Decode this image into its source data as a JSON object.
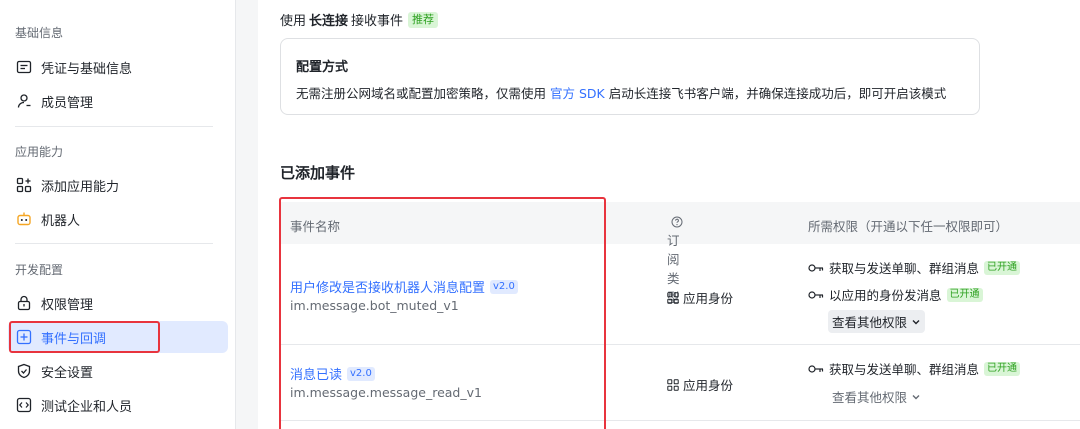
{
  "sidebar": {
    "sections": [
      {
        "title": "基础信息",
        "items": [
          {
            "label": "凭证与基础信息",
            "icon": "id-card-icon"
          },
          {
            "label": "成员管理",
            "icon": "user-icon"
          }
        ]
      },
      {
        "title": "应用能力",
        "items": [
          {
            "label": "添加应用能力",
            "icon": "apps-plus-icon"
          },
          {
            "label": "机器人",
            "icon": "robot-icon"
          }
        ]
      },
      {
        "title": "开发配置",
        "items": [
          {
            "label": "权限管理",
            "icon": "lock-icon"
          },
          {
            "label": "事件与回调",
            "icon": "event-icon"
          },
          {
            "label": "安全设置",
            "icon": "shield-icon"
          },
          {
            "label": "测试企业和人员",
            "icon": "code-icon"
          }
        ]
      }
    ],
    "active_item": "事件与回调"
  },
  "main": {
    "mode": {
      "prefix": "使用",
      "strong": "长连接",
      "suffix": "接收事件",
      "badge": "推荐"
    },
    "config": {
      "title": "配置方式",
      "desc_before": "无需注册公网域名或配置加密策略，仅需使用",
      "link": "官方 SDK",
      "desc_after": "启动长连接飞书客户端，并确保连接成功后，即可开启该模式"
    },
    "added_title": "已添加事件",
    "table": {
      "headers": {
        "name": "事件名称",
        "type": "订阅类型",
        "perm": "所需权限（开通以下任一权限即可）"
      },
      "rows": [
        {
          "name": "用户修改是否接收机器人消息配置",
          "version": "v2.0",
          "code": "im.message.bot_muted_v1",
          "type": "应用身份",
          "perms": [
            {
              "label": "获取与发送单聊、群组消息",
              "status": "已开通"
            },
            {
              "label": "以应用的身份发消息",
              "status": "已开通"
            }
          ],
          "more": "查看其他权限"
        },
        {
          "name": "消息已读",
          "version": "v2.0",
          "code": "im.message.message_read_v1",
          "type": "应用身份",
          "perms": [
            {
              "label": "获取与发送单聊、群组消息",
              "status": "已开通"
            }
          ],
          "more": "查看其他权限"
        }
      ]
    }
  },
  "colors": {
    "accent": "#3370ff",
    "annotation": "#e8343e",
    "success": "#2ea121"
  }
}
